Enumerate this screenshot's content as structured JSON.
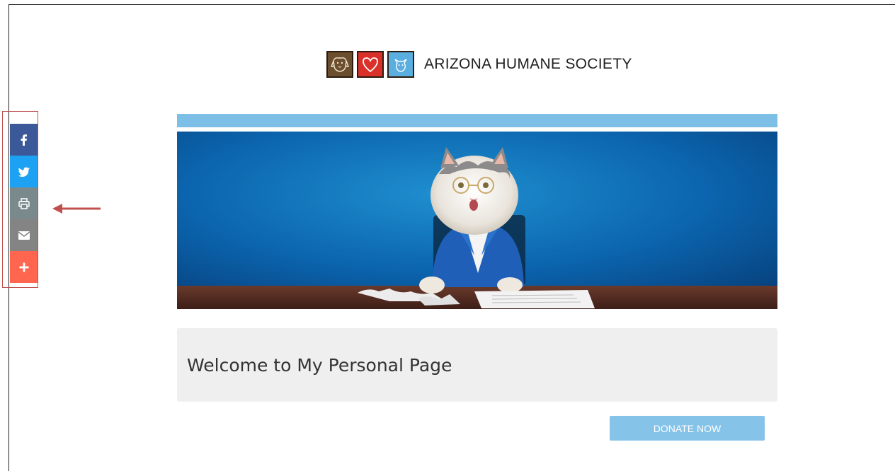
{
  "header": {
    "org_name": "ARIZONA HUMANE SOCIETY",
    "logo_icons": [
      "dog-icon",
      "heart-icon",
      "cat-icon"
    ]
  },
  "hero": {
    "image": "cat-in-suit-at-desk"
  },
  "welcome": {
    "title": "Welcome to My Personal Page"
  },
  "donate": {
    "label": "DONATE NOW"
  },
  "share_bar": {
    "items": [
      {
        "name": "facebook",
        "icon": "facebook-icon",
        "color": "#3b5998"
      },
      {
        "name": "twitter",
        "icon": "twitter-icon",
        "color": "#1da1f2"
      },
      {
        "name": "print",
        "icon": "print-icon",
        "color": "#7a8a8c"
      },
      {
        "name": "email",
        "icon": "email-icon",
        "color": "#848484"
      },
      {
        "name": "more",
        "icon": "plus-icon",
        "color": "#ff6650"
      }
    ]
  },
  "colors": {
    "accent": "#7dbfe6",
    "donate": "#85c3e8",
    "annotation": "#c0504d"
  }
}
